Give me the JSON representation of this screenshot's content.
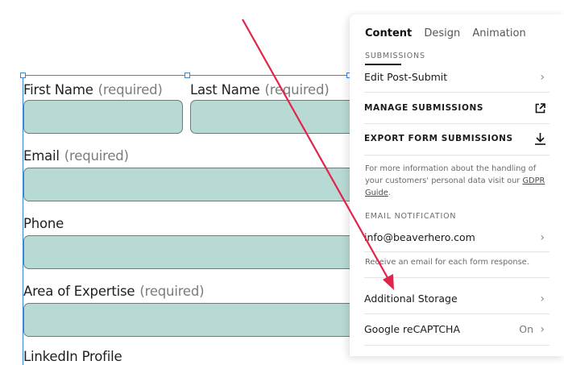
{
  "form": {
    "fields": [
      {
        "label": "First Name",
        "required": "(required)"
      },
      {
        "label": "Last Name",
        "required": "(required)"
      },
      {
        "label": "Email",
        "required": "(required)"
      },
      {
        "label": "Phone",
        "required": ""
      },
      {
        "label": "Area of Expertise",
        "required": "(required)"
      },
      {
        "label": "LinkedIn Profile",
        "required": ""
      }
    ],
    "field_color": "#b8dad4",
    "selection_color": "#3a86d6"
  },
  "panel": {
    "tabs": [
      {
        "label": "Content",
        "active": true
      },
      {
        "label": "Design",
        "active": false
      },
      {
        "label": "Animation",
        "active": false
      }
    ],
    "submissions_section": "SUBMISSIONS",
    "edit_post_submit": "Edit Post-Submit",
    "manage_submissions": "MANAGE SUBMISSIONS",
    "export_submissions": "EXPORT FORM SUBMISSIONS",
    "privacy_text_1": "For more information about the handling of your customers' personal data visit our ",
    "privacy_link": "GDPR Guide",
    "privacy_text_2": ".",
    "email_section": "EMAIL NOTIFICATION",
    "email_value": "info@beaverhero.com",
    "email_help": "Receive an email for each form response.",
    "additional_storage": "Additional Storage",
    "recaptcha_label": "Google reCAPTCHA",
    "recaptcha_value": "On"
  },
  "annotation": {
    "arrow_color": "#e0244a"
  }
}
